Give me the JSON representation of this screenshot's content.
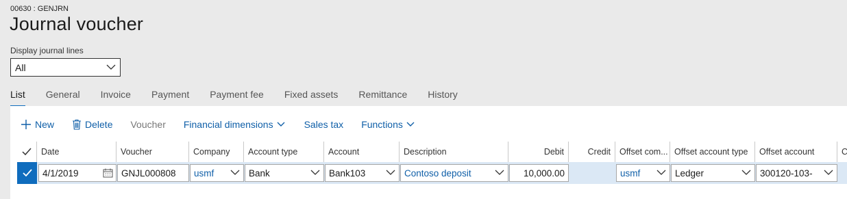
{
  "header": {
    "breadcrumb": "00630 : GENJRN",
    "title": "Journal voucher"
  },
  "filter": {
    "label": "Display journal lines",
    "selected": "All"
  },
  "tabs": [
    {
      "label": "List",
      "active": true
    },
    {
      "label": "General"
    },
    {
      "label": "Invoice"
    },
    {
      "label": "Payment"
    },
    {
      "label": "Payment fee"
    },
    {
      "label": "Fixed assets"
    },
    {
      "label": "Remittance"
    },
    {
      "label": "History"
    }
  ],
  "toolbar": {
    "new_label": "New",
    "delete_label": "Delete",
    "voucher_label": "Voucher",
    "financial_dimensions_label": "Financial dimensions",
    "sales_tax_label": "Sales tax",
    "functions_label": "Functions"
  },
  "grid": {
    "columns": {
      "date": "Date",
      "voucher": "Voucher",
      "company": "Company",
      "account_type": "Account type",
      "account": "Account",
      "description": "Description",
      "debit": "Debit",
      "credit": "Credit",
      "offset_company": "Offset com...",
      "offset_account_type": "Offset account type",
      "offset_account": "Offset account",
      "more": "C"
    },
    "rows": [
      {
        "selected": true,
        "date": "4/1/2019",
        "voucher": "GNJL000808",
        "company": "usmf",
        "account_type": "Bank",
        "account": "Bank103",
        "description": "Contoso deposit",
        "debit": "10,000.00",
        "credit": "",
        "offset_company": "usmf",
        "offset_account_type": "Ledger",
        "offset_account": "300120-103-"
      }
    ]
  },
  "colors": {
    "accent": "#0f6cbd",
    "link": "#0f5fa8",
    "selected_row": "#dbe8f5",
    "background": "#eaeaea"
  }
}
